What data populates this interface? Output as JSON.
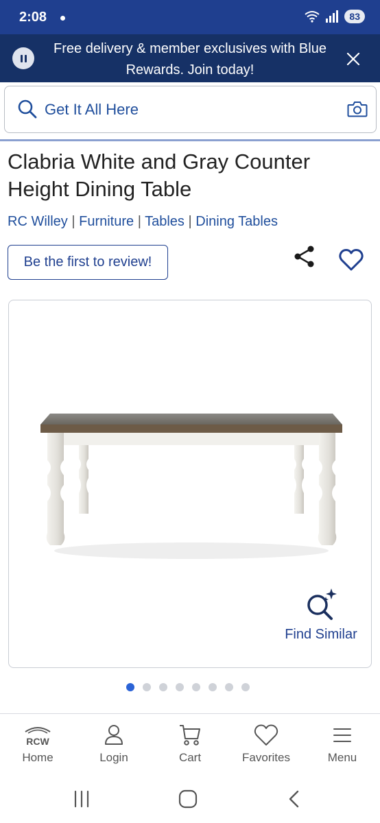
{
  "status_bar": {
    "time": "2:08",
    "battery": "83"
  },
  "promo": {
    "text": "Free delivery & member exclusives with Blue Rewards. Join today!"
  },
  "search": {
    "placeholder": "Get It All Here"
  },
  "product": {
    "title": "Clabria White and Gray Counter Height Dining Table",
    "breadcrumb": [
      "RC Willey",
      "Furniture",
      "Tables",
      "Dining Tables"
    ],
    "breadcrumb_separator": "|",
    "review_label": "Be the first to review!"
  },
  "gallery": {
    "find_similar_label": "Find Similar",
    "image_count": 8,
    "active_index": 0
  },
  "bottom_nav": {
    "home_logo_text": "RCW",
    "items": [
      {
        "label": "Home",
        "icon": "home-logo-icon"
      },
      {
        "label": "Login",
        "icon": "user-icon"
      },
      {
        "label": "Cart",
        "icon": "cart-icon"
      },
      {
        "label": "Favorites",
        "icon": "heart-icon"
      },
      {
        "label": "Menu",
        "icon": "hamburger-icon"
      }
    ]
  },
  "colors": {
    "header_blue": "#1f3f8f",
    "promo_navy": "#163166",
    "link_blue": "#1f4e9c",
    "active_dot": "#2b63d6"
  }
}
